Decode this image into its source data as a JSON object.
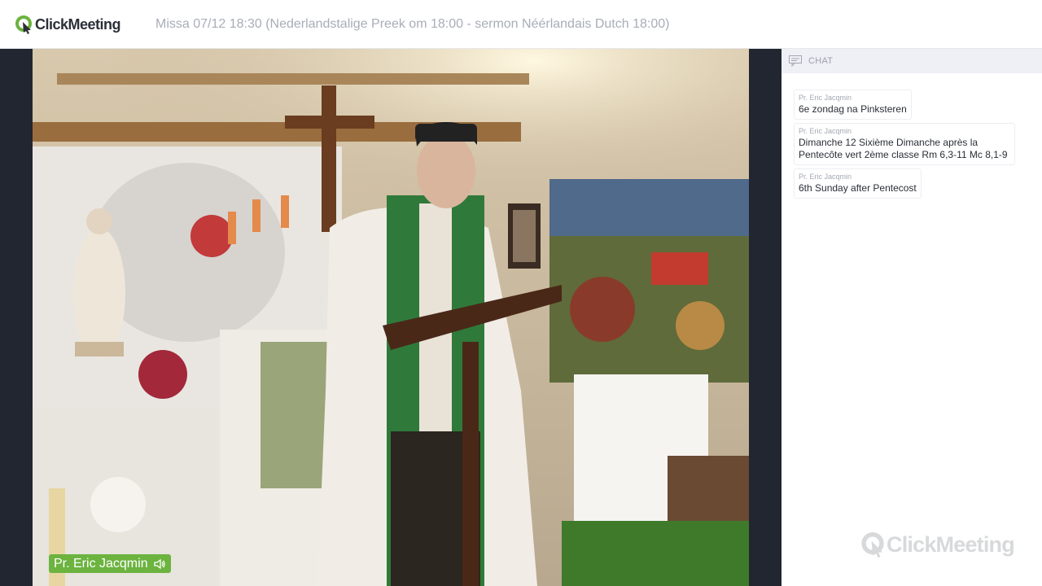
{
  "header": {
    "logo_text": "ClickMeeting",
    "title": "Missa 07/12 18:30 (Nederlandstalige Preek om 18:00 - sermon Néérlandais Dutch 18:00)"
  },
  "video": {
    "presenter_name": "Pr. Eric Jacqmin"
  },
  "chat": {
    "header_label": "CHAT",
    "messages": [
      {
        "author": "Pr. Eric Jacqmin",
        "text": "6e zondag na Pinksteren"
      },
      {
        "author": "Pr. Eric Jacqmin",
        "text": "Dimanche 12 Sixième Dimanche après la Pentecôte vert 2ème classe Rm 6,3-11 Mc 8,1-9"
      },
      {
        "author": "Pr. Eric Jacqmin",
        "text": "6th Sunday after Pentecost"
      }
    ],
    "watermark_text": "ClickMeeting"
  },
  "colors": {
    "brand_green": "#6cb33f",
    "dark_bg": "#212631",
    "chat_header_bg": "#eef0f5"
  },
  "icons": [
    "clickmeeting-logo-icon",
    "speaker-icon",
    "chat-icon"
  ]
}
